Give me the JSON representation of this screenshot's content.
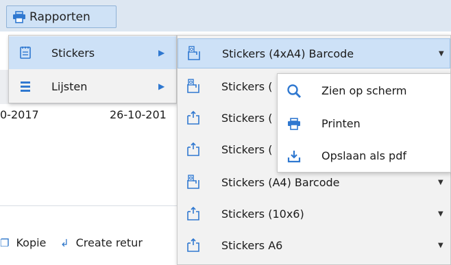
{
  "colors": {
    "accent": "#2f78d0",
    "menu_bg": "#f2f2f2",
    "highlight": "#cde1f7",
    "topband": "#dde7f2"
  },
  "toolbar": {
    "rapporten_label": "Rapporten",
    "rapporten_icon": "printer-icon"
  },
  "background": {
    "date_left": "0-2017",
    "date_right": "26-10-201",
    "actions": [
      {
        "label": "Kopie",
        "icon": "copy-icon"
      },
      {
        "label": "Create retur",
        "icon": "return-arrow-icon"
      }
    ]
  },
  "menu1": {
    "items": [
      {
        "label": "Stickers",
        "icon": "sticker-sheet-icon",
        "active": true
      },
      {
        "label": "Lijsten",
        "icon": "list-icon",
        "active": false
      }
    ]
  },
  "menu2": {
    "items": [
      {
        "label": "Stickers (4xA4) Barcode",
        "icon": "barcode-sticker-icon",
        "active": true
      },
      {
        "label": "Stickers (",
        "icon": "barcode-sticker-icon"
      },
      {
        "label": "Stickers (",
        "icon": "sticker-icon"
      },
      {
        "label": "Stickers (",
        "icon": "sticker-icon"
      },
      {
        "label": "Stickers (A4) Barcode",
        "icon": "barcode-sticker-icon"
      },
      {
        "label": "Stickers (10x6)",
        "icon": "sticker-icon"
      },
      {
        "label": "Stickers A6",
        "icon": "sticker-icon"
      }
    ]
  },
  "menu3": {
    "items": [
      {
        "label": "Zien op scherm",
        "icon": "magnifier-icon"
      },
      {
        "label": "Printen",
        "icon": "printer-icon"
      },
      {
        "label": "Opslaan als pdf",
        "icon": "download-icon"
      }
    ]
  }
}
